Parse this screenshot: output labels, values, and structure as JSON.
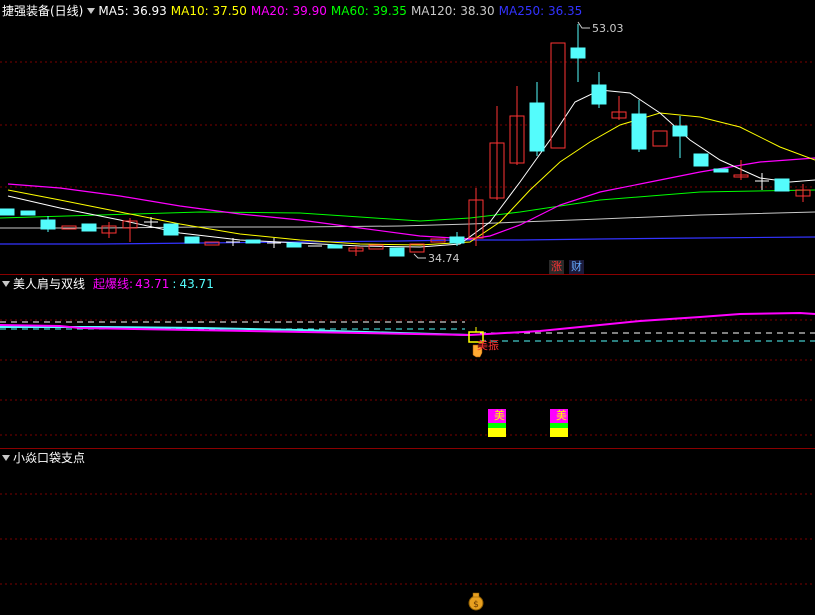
{
  "main": {
    "title": "捷强装备(日线)",
    "ma_labels": [
      {
        "text": "MA5: 36.93",
        "color": "#ffffff"
      },
      {
        "text": "MA10: 37.50",
        "color": "#ffff00"
      },
      {
        "text": "MA20: 39.90",
        "color": "#ff00ff"
      },
      {
        "text": "MA60: 39.35",
        "color": "#00ff00"
      },
      {
        "text": "MA120: 38.30",
        "color": "#c8c8c8"
      },
      {
        "text": "MA250: 36.35",
        "color": "#3333ff"
      }
    ],
    "high_label": "53.03",
    "low_label": "34.74",
    "badge_zhang": "涨",
    "badge_cai": "财"
  },
  "indicator1": {
    "name": "美人肩与双线",
    "label": "起爆线:",
    "value1": "43.71",
    "separator": ":",
    "value2": "43.71",
    "signal_text": "美振",
    "bar_labels": [
      "美",
      "美"
    ]
  },
  "indicator2": {
    "name": "小焱口袋支点"
  },
  "colors": {
    "up": "#ff3333",
    "down": "#54fcfc",
    "grid": "#8a0000",
    "ma5": "#ffffff",
    "ma10": "#ffff00",
    "ma20": "#ff00ff",
    "ma60": "#00ff00",
    "ma120": "#c8c8c8",
    "ma250": "#3333ff"
  }
}
